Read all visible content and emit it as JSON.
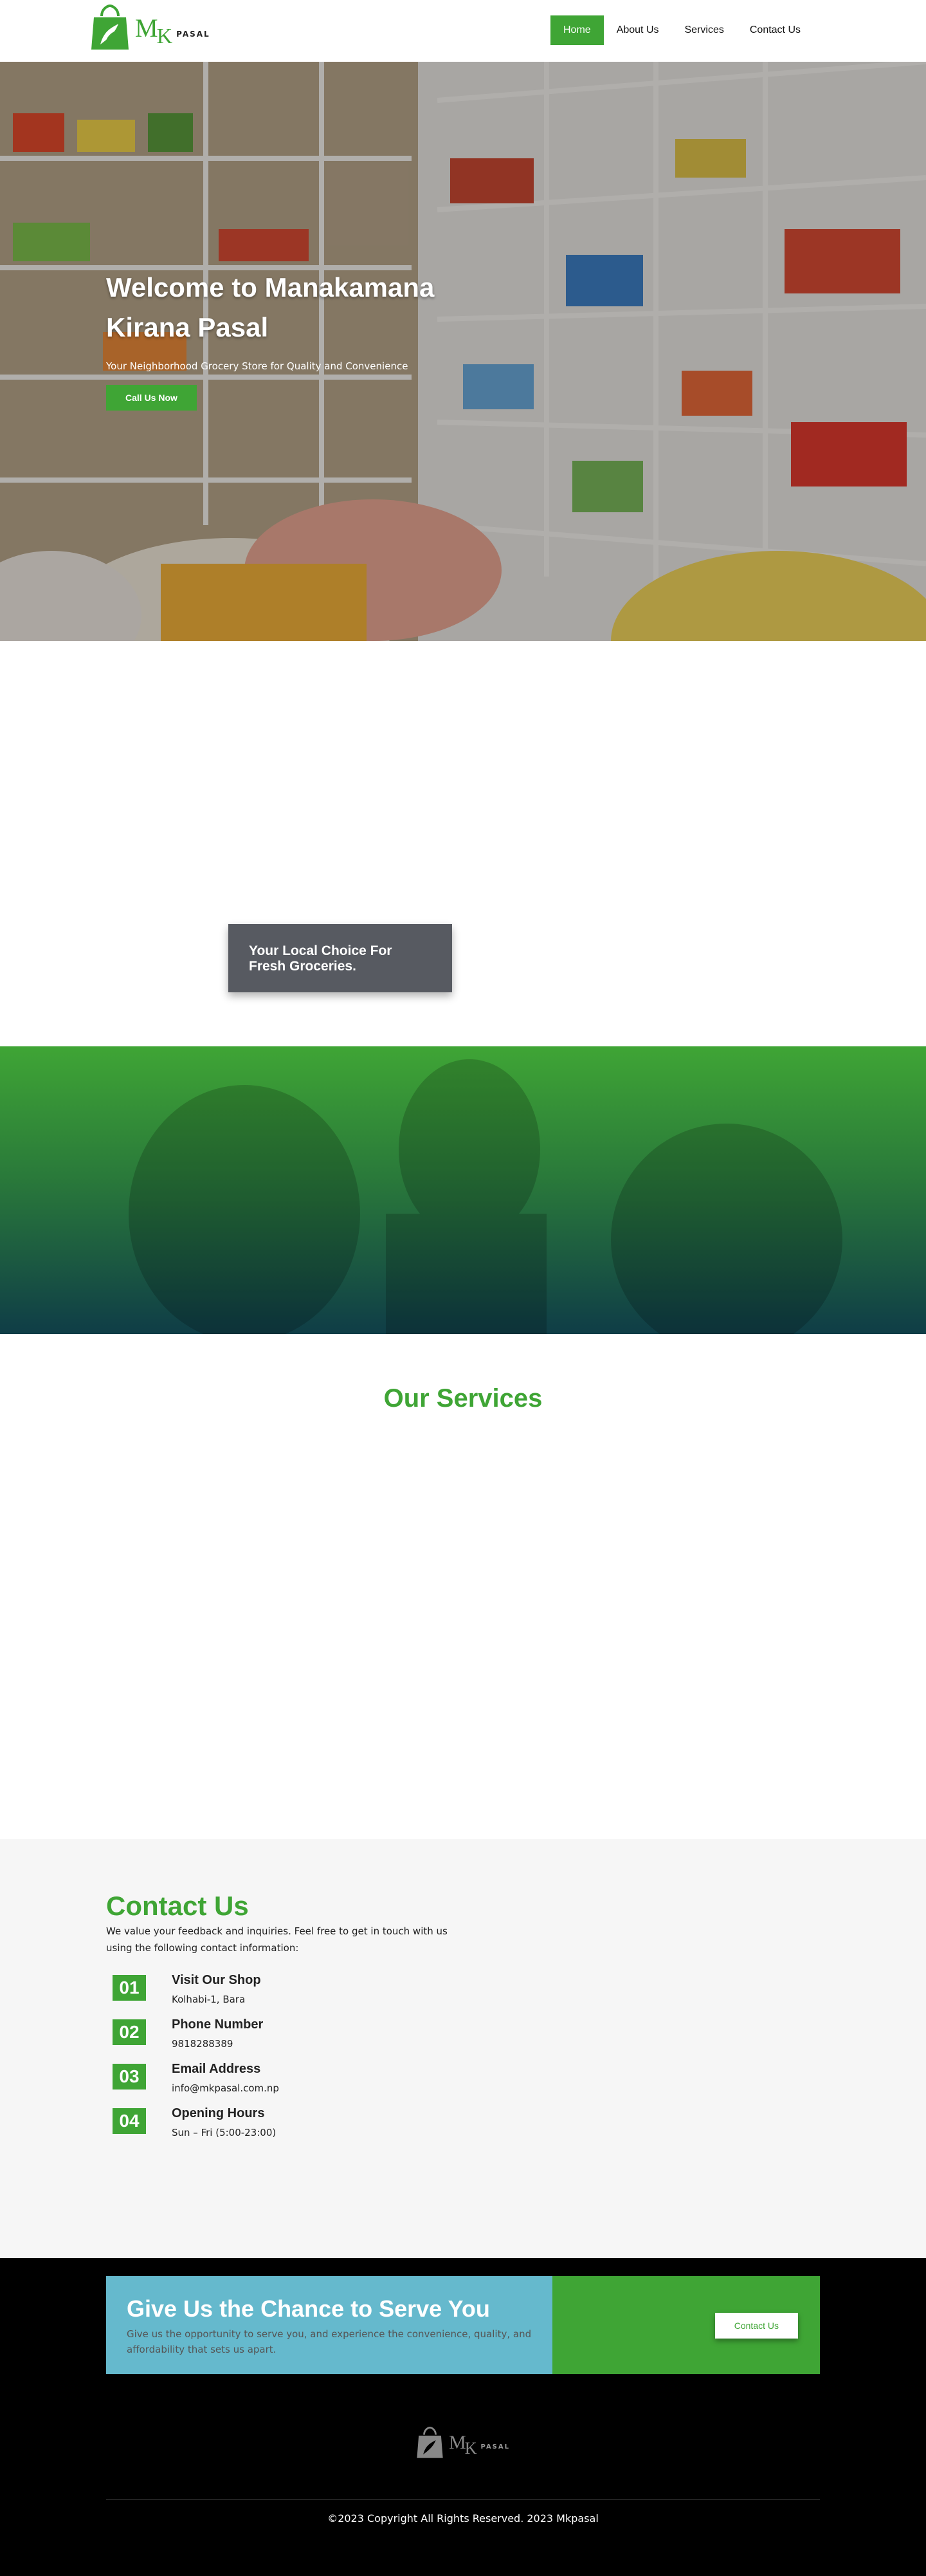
{
  "brand": {
    "m": "M",
    "k": "K",
    "pasal": "PASAL",
    "color": "#3fa535"
  },
  "nav": {
    "items": [
      {
        "label": "Home",
        "active": true
      },
      {
        "label": "About Us"
      },
      {
        "label": "Services"
      },
      {
        "label": "Contact Us"
      }
    ]
  },
  "hero": {
    "title": "Welcome to Manakamana Kirana Pasal",
    "subtitle": "Your Neighborhood Grocery Store for Quality and Convenience",
    "button": "Call Us Now"
  },
  "about": {
    "card_text": "Your Local Choice For Fresh Groceries."
  },
  "services": {
    "heading": "Our Services"
  },
  "contact": {
    "heading": "Contact Us",
    "intro": "We value your feedback and inquiries. Feel free to get in touch with us using the following contact information:",
    "items": [
      {
        "num": "01",
        "title": "Visit Our Shop",
        "value": "Kolhabi-1, Bara"
      },
      {
        "num": "02",
        "title": "Phone Number",
        "value": "9818288389"
      },
      {
        "num": "03",
        "title": "Email Address",
        "value": "info@mkpasal.com.np"
      },
      {
        "num": "04",
        "title": "Opening Hours",
        "value": "Sun – Fri (5:00-23:00)"
      }
    ]
  },
  "cta": {
    "title": "Give Us the Chance to Serve You",
    "text": "Give us the opportunity to serve you, and experience the convenience, quality, and affordability that sets us apart.",
    "button": "Contact Us"
  },
  "footer": {
    "copyright": "©2023 Copyright All Rights Reserved.  2023 Mkpasal"
  },
  "colors": {
    "accent": "#3fa535",
    "cta_blue": "#65b9cd",
    "card_gray": "#575a61"
  }
}
